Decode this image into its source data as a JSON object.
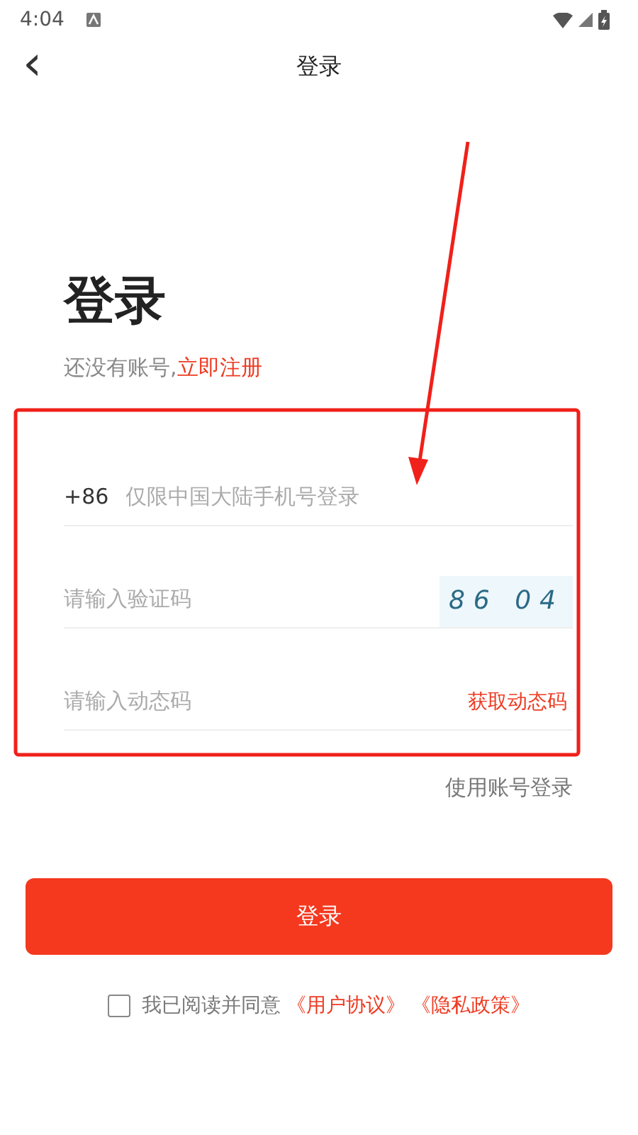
{
  "status_bar": {
    "time": "4:04"
  },
  "header": {
    "back": "‹",
    "title": "登录"
  },
  "heading": "登录",
  "register_prompt": {
    "text": "还没有账号,",
    "link": "立即注册"
  },
  "fields": [
    {
      "kind": "phone",
      "prefix": "+86",
      "placeholder": "仅限中国大陆手机号登录"
    },
    {
      "kind": "captcha",
      "placeholder": "请输入验证码",
      "captcha": "86 04"
    },
    {
      "kind": "sms",
      "placeholder": "请输入动态码",
      "action": "获取动态码"
    }
  ],
  "account_login": "使用账号登录",
  "login_button": "登录",
  "agreement": {
    "checked": false,
    "text": "我已阅读并同意",
    "links": [
      "《用户协议》",
      "《隐私政策》"
    ]
  }
}
